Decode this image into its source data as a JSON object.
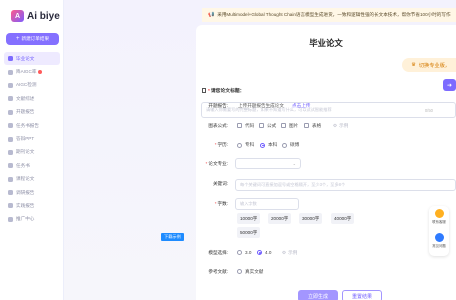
{
  "brand": {
    "logo_letter": "A",
    "name": "Ai biye"
  },
  "sidebar": {
    "new_button": "新建订单结果",
    "items": [
      {
        "label": "毕业论文",
        "active": true
      },
      {
        "label": "降AIGC率",
        "badge": true
      },
      {
        "label": "AIGC检测"
      },
      {
        "label": "文献综述"
      },
      {
        "label": "开题报告"
      },
      {
        "label": "任务书报告"
      },
      {
        "label": "答辩PPT"
      },
      {
        "label": "期刊论文"
      },
      {
        "label": "任务书"
      },
      {
        "label": "课程论文"
      },
      {
        "label": "调研报告"
      },
      {
        "label": "实践报告"
      },
      {
        "label": "推广中心"
      }
    ]
  },
  "notice": {
    "icon": "speaker-icon",
    "text": "采用Multimodel+Global Thought Chain语言模型生成进货，一致和逻辑性强的长文本技术，帮你节省100小时的写作"
  },
  "main": {
    "title": "毕业论文",
    "pro_badge": "切换专业版，",
    "title_label": "请您论文标题：",
    "title_placeholder": "请输入你需要写的完整标题，如果不知道写什么，可以试试智能推荐",
    "title_counter": "0/50",
    "gen_button_icon": "arrow-right-icon",
    "proposal_label": "开题报告:",
    "proposal_hint": "上传开题报告生成论文",
    "proposal_link": "点击上传",
    "charts_label": "图表公式:",
    "charts_options": [
      "代码",
      "公式",
      "图片",
      "表格"
    ],
    "charts_extra": "示例",
    "degree_label": "学历:",
    "degree_options": [
      "专科",
      "本科",
      "硕博"
    ],
    "degree_selected": "本科",
    "major_label": "论文专业:",
    "keywords_label": "关键词:",
    "keywords_placeholder": "每个关键词可直接加逗号或空格隔开，至少3个，至多8个",
    "wordcount_label": "字数:",
    "wordcount_placeholder": "输入字数",
    "wordcount_chips": [
      "10000字",
      "20000字",
      "30000字",
      "40000字",
      "50000字"
    ],
    "model_label": "模型选择:",
    "model_options": [
      "3.0",
      "4.0"
    ],
    "model_selected": "4.0",
    "model_extra": "示例",
    "refs_label": "参考文献:",
    "refs_option": "真实文献",
    "submit_button": "立即生成",
    "reset_button": "重置结果"
  },
  "tooltip": "下载示例",
  "float_panel": {
    "contact": "联系客服",
    "feedback": "常见问题"
  },
  "colors": {
    "accent": "#7d6bff",
    "notice_bg": "#fff7e6",
    "pro_badge": "#d47a00",
    "tooltip": "#1e8bff"
  }
}
